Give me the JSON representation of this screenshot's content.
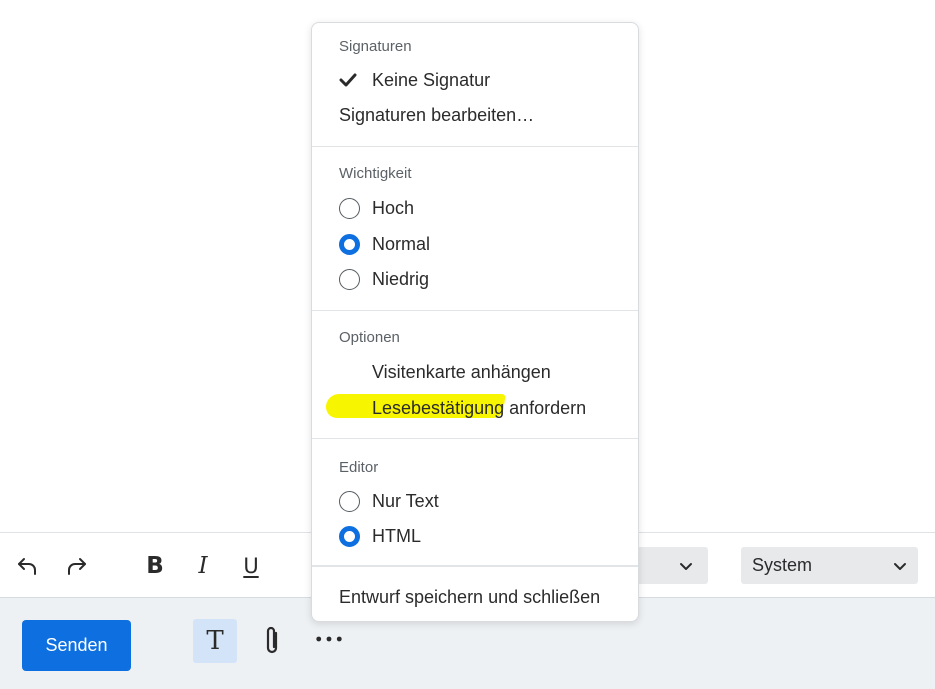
{
  "toolbar": {
    "undo_icon": "undo-icon",
    "redo_icon": "redo-icon",
    "bold_label": "B",
    "italic_label": "I",
    "underline_label": "U",
    "font_select_value": "System"
  },
  "actions": {
    "send_label": "Senden",
    "text_format_label": "T",
    "attach_icon": "paperclip-icon",
    "more_icon": "more-horizontal-icon"
  },
  "menu": {
    "signatures": {
      "header": "Signaturen",
      "items": [
        {
          "label": "Keine Signatur",
          "checked": true
        },
        {
          "label": "Signaturen bearbeiten…",
          "checked": false
        }
      ]
    },
    "importance": {
      "header": "Wichtigkeit",
      "options": [
        {
          "label": "Hoch",
          "selected": false
        },
        {
          "label": "Normal",
          "selected": true
        },
        {
          "label": "Niedrig",
          "selected": false
        }
      ]
    },
    "options": {
      "header": "Optionen",
      "items": [
        {
          "label": "Visitenkarte anhängen"
        },
        {
          "label": "Lesebestätigung anfordern"
        }
      ]
    },
    "editor": {
      "header": "Editor",
      "options": [
        {
          "label": "Nur Text",
          "selected": false
        },
        {
          "label": "HTML",
          "selected": true
        }
      ]
    },
    "save_draft_label": "Entwurf speichern und schließen"
  },
  "colors": {
    "accent": "#0d6fe0",
    "highlight": "#f8f500",
    "action_bar_bg": "#eef1f4",
    "active_button_bg": "#d3e4f8"
  }
}
